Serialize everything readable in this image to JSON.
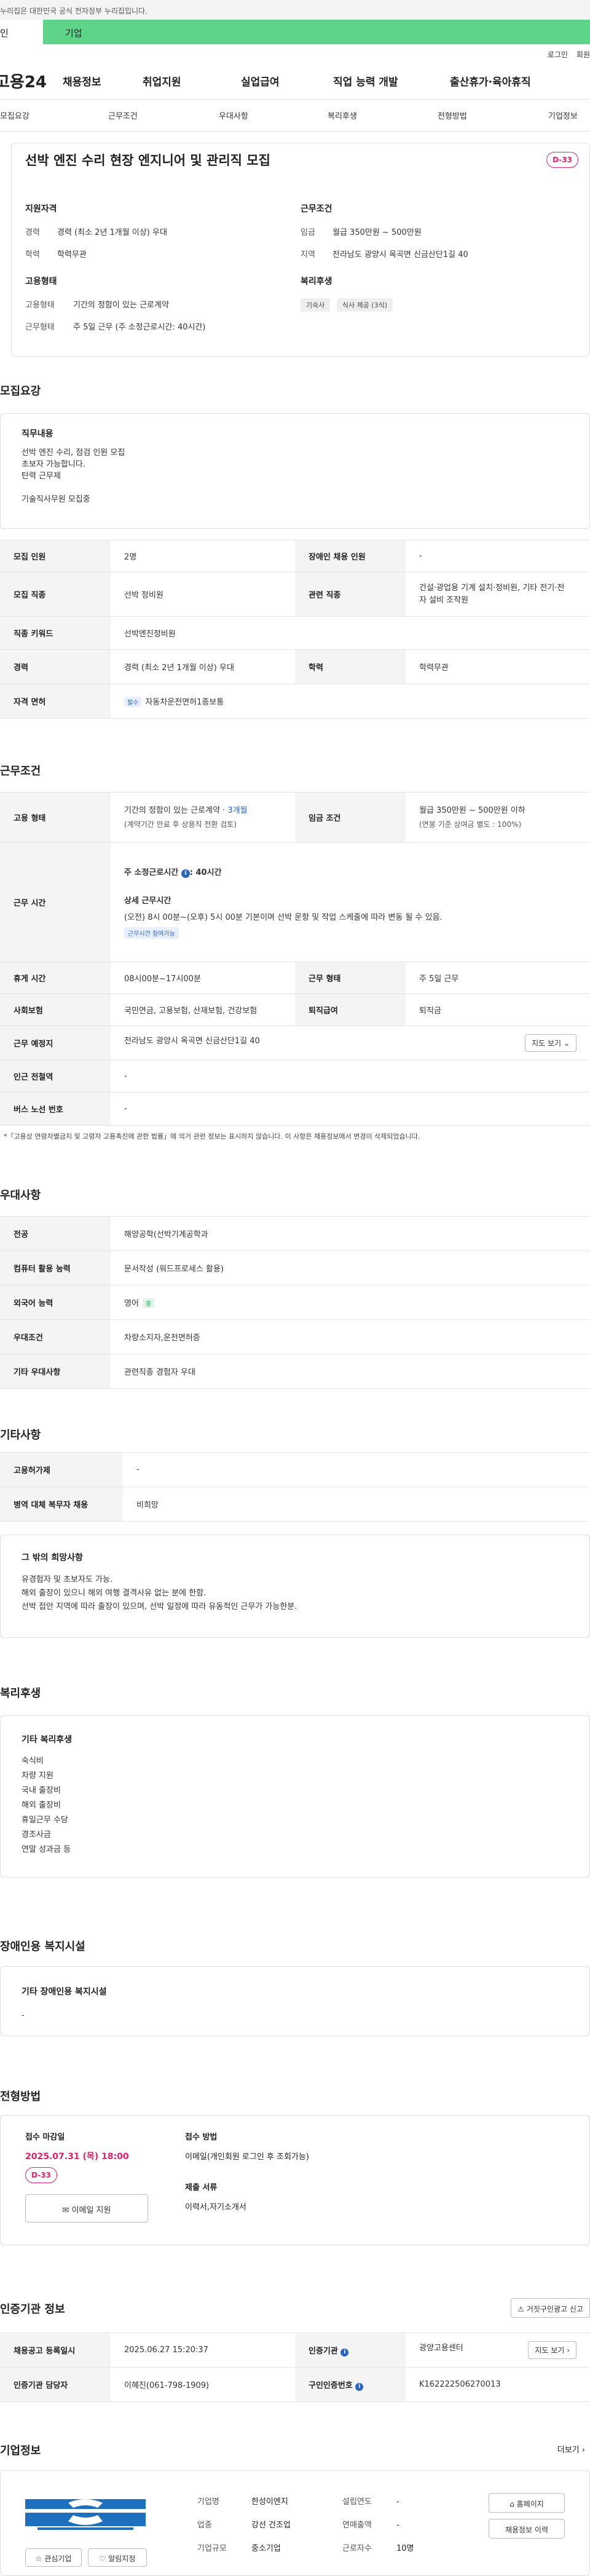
{
  "gov_notice": "누리집은 대한민국 공식 전자정부 누리집입니다.",
  "mode_tabs": {
    "personal": "인",
    "business": "기업"
  },
  "util": {
    "login": "로그인",
    "signup": "회원"
  },
  "logo": "고용24",
  "gnb": [
    "채용정보",
    "취업지원",
    "실업급여",
    "직업 능력 개발",
    "출산휴가·육아휴직"
  ],
  "subnav": [
    "모집요강",
    "근무조건",
    "우대사항",
    "복리후생",
    "전형방법",
    "기업정보"
  ],
  "summary": {
    "title": "선박 엔진 수리 현장 엔지니어 및 관리직 모집",
    "dday": "D-33",
    "qual_head": "지원자격",
    "career_k": "경력",
    "career_v": "경력 (최소 2년 1개월 이상) 우대",
    "edu_k": "학력",
    "edu_v": "학력무관",
    "emp_head": "고용형태",
    "type_k": "고용형태",
    "type_v": "기간의 정함이 있는 근로계약",
    "work_k": "근무형태",
    "work_v": "주 5일 근무 (주 소정근로시간: 40시간)",
    "cond_head": "근무조건",
    "wage_k": "임금",
    "wage_v": "월급 350만원 ~ 500만원",
    "area_k": "지역",
    "area_v": "전라남도 광양시 옥곡면 신금산단1길 40",
    "welfare_head": "복리후생",
    "chips": [
      "기숙사",
      "식사 제공 (3식)"
    ]
  },
  "recruit": {
    "title": "모집요강",
    "duty_head": "직무내용",
    "duty_lines": [
      "선박 엔진 수리, 점검 인원 모집",
      "초보자 가능합니다.",
      "탄력 근무제",
      "",
      "기술직사무원 모집중"
    ],
    "rows": {
      "count_k": "모집 인원",
      "count_v": "2명",
      "dis_k": "장애인 채용 인원",
      "dis_v": "-",
      "job_k": "모집 직종",
      "job_v": "선박 정비원",
      "rel_k": "관련 직종",
      "rel_v1": "건설·광업용 기계 설치·정비원, 기타 전기·전",
      "rel_v2": "자 설비 조작원",
      "kw_k": "직종 키워드",
      "kw_v": "선박엔진정비원",
      "career_k": "경력",
      "career_v": "경력 (최소 2년 1개월 이상) 우대",
      "edu_k": "학력",
      "edu_v": "학력무관",
      "lic_k": "자격 면허",
      "lic_tag": "필수",
      "lic_v": "자동차운전면허1종보통"
    }
  },
  "work": {
    "title": "근무조건",
    "type_k": "고용 형태",
    "type_v1": "기간의 정함이 있는 근로계약 · ",
    "type_v1_blue": "3개월",
    "type_v2": "(계약기간 만료 후 상용직 전환 검토)",
    "wage_k": "임금 조건",
    "wage_v1": "월급 350만원 ~ 500만원 이하",
    "wage_v2": "(연봉 기준 상여금 별도 : 100%)",
    "time_k": "근무 시간",
    "time_week": "주 소정근로시간",
    "time_week_v": "40시간",
    "time_detail_head": "상세 근무시간",
    "time_detail": "(오전) 8시 00분~(오후) 5시 00분 기본이며 선박 운항 및 작업 스케줄에 따라 변동 될 수 있음.",
    "time_tip": "근무시간 참여가능",
    "break_k": "휴게 시간",
    "break_v": "08시00분~17시00분",
    "form_k": "근무 형태",
    "form_v": "주 5일 근무",
    "ins_k": "사회보험",
    "ins_v": "국민연금, 고용보험, 산재보험, 건강보험",
    "ret_k": "퇴직급여",
    "ret_v": "퇴직금",
    "place_k": "근무 예정지",
    "place_v": "전라남도 광양시 옥곡면 신금산단1길 40",
    "map_btn": "지도 보기",
    "station_k": "인근 전철역",
    "station_v": "-",
    "bus_k": "버스 노선 번호",
    "bus_v": "-",
    "note": "*「고용상 연령차별금지 및 고령자 고용촉진에 관한 법률」에 의거 관련 정보는 표시하지 않습니다. 이 사항은 채용정보에서 변경이 삭제되었습니다."
  },
  "pref": {
    "title": "우대사항",
    "major_k": "전공",
    "major_v": "해양공학(선박기계공학과",
    "comp_k": "컴퓨터 활용 능력",
    "comp_v": "문서작성 (워드프로세스 활용)",
    "lang_k": "외국어 능력",
    "lang_v": "영어",
    "lang_tag": "중",
    "cond_k": "우대조건",
    "cond_v": "차량소지자,운전면허증",
    "etc_k": "기타 우대사항",
    "etc_v": "관련직종 경험자 우대"
  },
  "other": {
    "title": "기타사항",
    "disab_k": "고용허가제",
    "disab_v": "-",
    "army_k": "병역 대체 복무자 채용",
    "army_v": "비희망",
    "wish_head": "그 밖의 희망사항",
    "wish_lines": [
      "유경험자 및 초보자도 가능.",
      "해외 출장이 있으니 해외 여행 결격사유 없는 분에 한함.",
      "선박 접안 지역에 따라 출장이 있으며, 선박 일정에 따라 유동적인 근무가 가능한분."
    ]
  },
  "welfare": {
    "title": "복리후생",
    "head": "기타 복리후생",
    "items": [
      "숙식비",
      "차량 지원",
      "국내 출장비",
      "해외 출장비",
      "휴일근무 수당",
      "경조사금",
      "연말 성과금 등"
    ]
  },
  "disfac": {
    "title": "장애인용 복지시설",
    "head": "기타 장애인용 복지시설",
    "value": "-"
  },
  "process": {
    "title": "전형방법",
    "deadline_head": "접수 마감일",
    "deadline": "2025.07.31 (목) 18:00",
    "dday": "D-33",
    "email_btn": "이메일 지원",
    "method_head": "접수 방법",
    "method": "이메일(개인회원 로그인 후 조회가능)",
    "docs_head": "제출 서류",
    "docs": "이력서,자기소개서"
  },
  "agency": {
    "title": "인증기관 정보",
    "report_btn": "거짓구인광고 신고",
    "reg_k": "채용공고 등록일시",
    "reg_v": "2025.06.27 15:20:37",
    "org_k": "인증기관",
    "org_v": "광양고용센터",
    "map_btn": "지도 보기",
    "mgr_k": "인증기관 담당자",
    "mgr_v": "이혜진(061-798-1909)",
    "no_k": "구인인증번호",
    "no_v": "K162222506270013"
  },
  "company": {
    "title": "기업정보",
    "more": "더보기",
    "name_k": "기업명",
    "name_v": "한성이엔지",
    "found_k": "설립연도",
    "found_v": "-",
    "ind_k": "업종",
    "ind_v": "강선 건조업",
    "sales_k": "연매출액",
    "sales_v": "-",
    "size_k": "기업규모",
    "size_v": "중소기업",
    "emp_k": "근로자수",
    "emp_v": "10명",
    "fav_btn": "관심기업",
    "alarm_btn": "알림지정",
    "home_btn": "홈페이지",
    "jobs_btn": "채용정보 이력"
  },
  "colors": {
    "accent_green": "#5ed489",
    "dday_pink": "#e0206a",
    "link_blue": "#2c64c4"
  }
}
